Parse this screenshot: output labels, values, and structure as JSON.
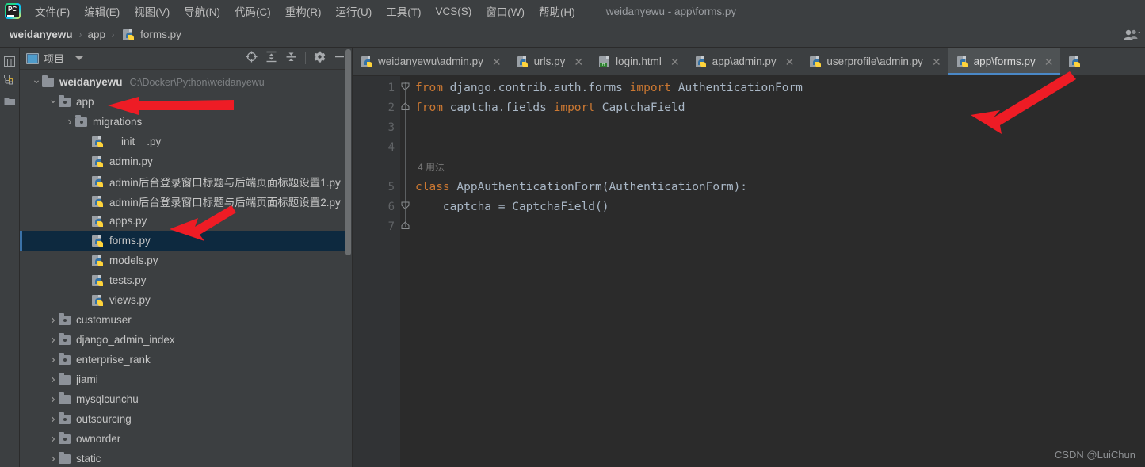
{
  "window": {
    "title": "weidanyewu - app\\forms.py"
  },
  "menubar": {
    "logo_text": "PC",
    "items": [
      {
        "label": "文件(F)",
        "mnemonic": "F"
      },
      {
        "label": "编辑(E)",
        "mnemonic": "E"
      },
      {
        "label": "视图(V)",
        "mnemonic": "V"
      },
      {
        "label": "导航(N)",
        "mnemonic": "N"
      },
      {
        "label": "代码(C)",
        "mnemonic": "C"
      },
      {
        "label": "重构(R)",
        "mnemonic": "R"
      },
      {
        "label": "运行(U)",
        "mnemonic": "U"
      },
      {
        "label": "工具(T)",
        "mnemonic": "T"
      },
      {
        "label": "VCS(S)",
        "mnemonic": "S"
      },
      {
        "label": "窗口(W)",
        "mnemonic": "W"
      },
      {
        "label": "帮助(H)",
        "mnemonic": "H"
      }
    ]
  },
  "breadcrumb": {
    "items": [
      "weidanyewu",
      "app",
      "forms.py"
    ],
    "separator": "›",
    "right_icon": "people-icon"
  },
  "toolstrip": {
    "items": [
      {
        "name": "project-tool-icon",
        "label": "项目"
      },
      {
        "name": "structure-tool-icon",
        "label": "结构"
      },
      {
        "name": "favorites-tool-icon",
        "label": "收藏夹"
      }
    ]
  },
  "project_panel": {
    "title": "项目",
    "dropdown_caret": "▾",
    "toolbar_icons": [
      {
        "name": "locate-file-icon",
        "title": "定位"
      },
      {
        "name": "expand-all-icon",
        "title": "全部展开"
      },
      {
        "name": "collapse-all-icon",
        "title": "全部折叠"
      },
      {
        "name": "settings-gear-icon",
        "title": "设置"
      },
      {
        "name": "hide-panel-icon",
        "title": "隐藏"
      }
    ],
    "tree": [
      {
        "label": "weidanyewu",
        "path_hint": "C:\\Docker\\Python\\weidanyewu",
        "indent": 0,
        "type": "folder-plain",
        "state": "open",
        "bold": true,
        "selected": false
      },
      {
        "label": "app",
        "path_hint": "",
        "indent": 1,
        "type": "folder-mod",
        "state": "open",
        "bold": false,
        "selected": false
      },
      {
        "label": "migrations",
        "path_hint": "",
        "indent": 2,
        "type": "folder-mod",
        "state": "closed",
        "bold": false,
        "selected": false
      },
      {
        "label": "__init__.py",
        "path_hint": "",
        "indent": 3,
        "type": "py",
        "state": "none",
        "bold": false,
        "selected": false
      },
      {
        "label": "admin.py",
        "path_hint": "",
        "indent": 3,
        "type": "py",
        "state": "none",
        "bold": false,
        "selected": false
      },
      {
        "label": "admin后台登录窗口标题与后端页面标题设置1.py",
        "path_hint": "",
        "indent": 3,
        "type": "py",
        "state": "none",
        "bold": false,
        "selected": false
      },
      {
        "label": "admin后台登录窗口标题与后端页面标题设置2.py",
        "path_hint": "",
        "indent": 3,
        "type": "py",
        "state": "none",
        "bold": false,
        "selected": false
      },
      {
        "label": "apps.py",
        "path_hint": "",
        "indent": 3,
        "type": "py",
        "state": "none",
        "bold": false,
        "selected": false
      },
      {
        "label": "forms.py",
        "path_hint": "",
        "indent": 3,
        "type": "py",
        "state": "none",
        "bold": false,
        "selected": true
      },
      {
        "label": "models.py",
        "path_hint": "",
        "indent": 3,
        "type": "py",
        "state": "none",
        "bold": false,
        "selected": false
      },
      {
        "label": "tests.py",
        "path_hint": "",
        "indent": 3,
        "type": "py",
        "state": "none",
        "bold": false,
        "selected": false
      },
      {
        "label": "views.py",
        "path_hint": "",
        "indent": 3,
        "type": "py",
        "state": "none",
        "bold": false,
        "selected": false
      },
      {
        "label": "customuser",
        "path_hint": "",
        "indent": 1,
        "type": "folder-mod",
        "state": "closed",
        "bold": false,
        "selected": false
      },
      {
        "label": "django_admin_index",
        "path_hint": "",
        "indent": 1,
        "type": "folder-mod",
        "state": "closed",
        "bold": false,
        "selected": false
      },
      {
        "label": "enterprise_rank",
        "path_hint": "",
        "indent": 1,
        "type": "folder-mod",
        "state": "closed",
        "bold": false,
        "selected": false
      },
      {
        "label": "jiami",
        "path_hint": "",
        "indent": 1,
        "type": "folder-plain",
        "state": "closed",
        "bold": false,
        "selected": false
      },
      {
        "label": "mysqlcunchu",
        "path_hint": "",
        "indent": 1,
        "type": "folder-plain",
        "state": "closed",
        "bold": false,
        "selected": false
      },
      {
        "label": "outsourcing",
        "path_hint": "",
        "indent": 1,
        "type": "folder-mod",
        "state": "closed",
        "bold": false,
        "selected": false
      },
      {
        "label": "ownorder",
        "path_hint": "",
        "indent": 1,
        "type": "folder-mod",
        "state": "closed",
        "bold": false,
        "selected": false
      },
      {
        "label": "static",
        "path_hint": "",
        "indent": 1,
        "type": "folder-plain",
        "state": "closed",
        "bold": false,
        "selected": false
      }
    ]
  },
  "editor": {
    "tabs": [
      {
        "label": "weidanyewu\\admin.py",
        "icon": "python-file-icon",
        "active": false,
        "closable": true
      },
      {
        "label": "urls.py",
        "icon": "python-file-icon",
        "active": false,
        "closable": true
      },
      {
        "label": "login.html",
        "icon": "html-file-icon",
        "active": false,
        "closable": true
      },
      {
        "label": "app\\admin.py",
        "icon": "python-file-icon",
        "active": false,
        "closable": true
      },
      {
        "label": "userprofile\\admin.py",
        "icon": "python-file-icon",
        "active": false,
        "closable": true
      },
      {
        "label": "app\\forms.py",
        "icon": "python-file-icon",
        "active": true,
        "closable": true
      }
    ],
    "close_glyph": "✕",
    "line_numbers": [
      "1",
      "2",
      "3",
      "4",
      "5",
      "6",
      "7"
    ],
    "lines": [
      {
        "num": "1",
        "tokens": [
          {
            "t": "from",
            "c": "kw"
          },
          {
            "t": " django.contrib.auth.forms ",
            "c": "plain"
          },
          {
            "t": "import",
            "c": "kw"
          },
          {
            "t": " AuthenticationForm",
            "c": "plain"
          }
        ]
      },
      {
        "num": "2",
        "tokens": [
          {
            "t": "from",
            "c": "kw"
          },
          {
            "t": " captcha.fields ",
            "c": "plain"
          },
          {
            "t": "import",
            "c": "kw"
          },
          {
            "t": " CaptchaField",
            "c": "plain"
          }
        ]
      },
      {
        "num": "3",
        "tokens": []
      },
      {
        "num": "4",
        "tokens": []
      },
      {
        "num": "5",
        "tokens": [
          {
            "t": "class",
            "c": "kw"
          },
          {
            "t": " AppAuthenticationForm(AuthenticationForm):",
            "c": "plain"
          }
        ]
      },
      {
        "num": "6",
        "tokens": [
          {
            "t": "    captcha = CaptchaField()",
            "c": "plain"
          }
        ]
      },
      {
        "num": "7",
        "tokens": []
      }
    ],
    "inlay_hint": "4 用法",
    "bulb_icon": "intention-bulb-icon"
  },
  "watermark": "CSDN @LuiChun",
  "colors": {
    "background": "#3c3f41",
    "editor_background": "#2b2b2b",
    "gutter_background": "#313335",
    "keyword": "#cc7832",
    "plain_code": "#a9b7c6",
    "selection": "#0d293f",
    "tab_active_underline": "#4a88c7",
    "annotation_arrow": "#ee1c25"
  }
}
